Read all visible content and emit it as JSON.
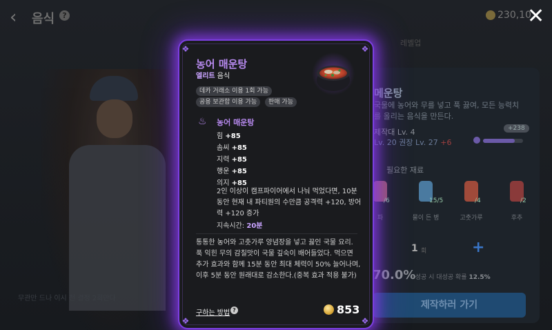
{
  "header": {
    "title": "음식",
    "help": "?",
    "coin_value": "230,10",
    "close": "✕"
  },
  "background": {
    "tabs": "레벨업",
    "note": "무관만 드나 이시 전 결정 2회만다",
    "craft": {
      "name": "메운탕",
      "desc": "국물에 농어와 무를 넣고 푹 끓여, 모든 능력치를 올리는 음식을 만든다.",
      "maker_lv": "제작대 Lv. 4",
      "lv_line_a": "Lv. 20",
      "lv_line_b": "권장 Lv. 27",
      "lv_line_c": "+6",
      "xp_badge": "+238",
      "xp_fraction": 0.8,
      "required_label": "필요한 재료",
      "materials": [
        {
          "name": "파",
          "count": "/6",
          "color": "#9a5a6a"
        },
        {
          "name": "물이 든 병",
          "count": "15/5",
          "color": "#4a7aa0"
        },
        {
          "name": "고춧가루",
          "count": "/4",
          "color": "#a04a3a"
        },
        {
          "name": "후추",
          "count": "/2",
          "color": "#8a3a3a"
        }
      ],
      "quantity": "1",
      "quantity_unit": "회",
      "plus": "+",
      "rate": "70.0%",
      "rate_sub_label": "성공 시 대성공 확률",
      "rate_sub_value": "12.5%",
      "button": "제작하러 가기"
    }
  },
  "item": {
    "name": "농어 매운탕",
    "grade": "엘리트",
    "category": "음식",
    "tags": [
      "데카 거래소 이용 1회 가능",
      "공용 보관함 이용 가능",
      "판매 가능"
    ],
    "effect_title": "농어 매운탕",
    "stats": [
      {
        "label": "힘",
        "value": "+85"
      },
      {
        "label": "솜씨",
        "value": "+85"
      },
      {
        "label": "지력",
        "value": "+85"
      },
      {
        "label": "행운",
        "value": "+85"
      },
      {
        "label": "의지",
        "value": "+85"
      }
    ],
    "effect_desc": "2인 이상이 캠프파이어에서 나눠 먹었다면, 10분 동안 현재 내 파티원의 수만큼 공격력 +120, 방어력 +120 증가",
    "duration_label": "지속시간:",
    "duration_value": "20분",
    "flavor": "통통한 농어와 고춧가루 양념장을 넣고 끓인 국물 요리. 푹 익힌 무의 감칠맛이 국물 깊숙이 배어들었다. 먹으면 추가 효과와 함께 15분 동안 최대 체력이 50% 늘어나며, 이후 5분 동안 원래대로 감소한다.(중복 효과 적용 불가)",
    "how_to_get": "구하는 방법",
    "price": "853"
  }
}
